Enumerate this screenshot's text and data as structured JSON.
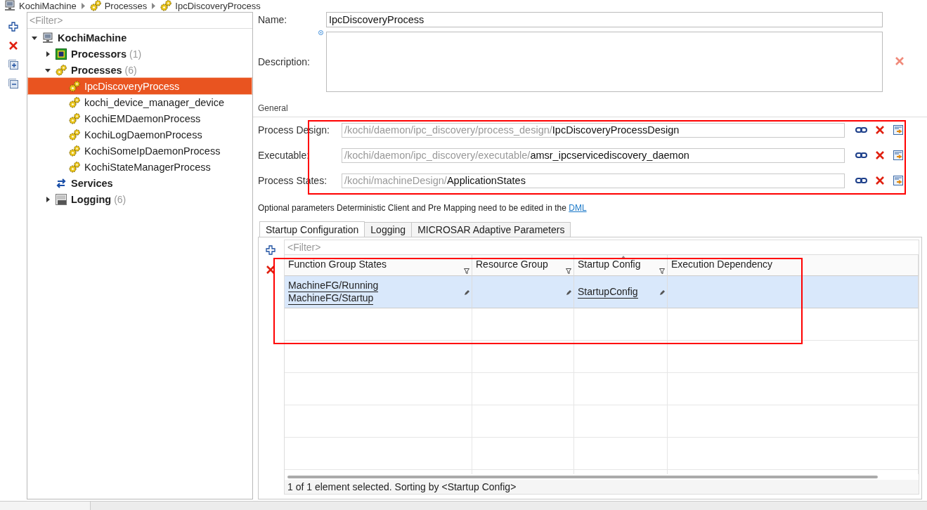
{
  "breadcrumb": [
    {
      "label": "KochiMachine",
      "kind": "machine"
    },
    {
      "label": "Processes",
      "kind": "process"
    },
    {
      "label": "IpcDiscoveryProcess",
      "kind": "process"
    }
  ],
  "tree": {
    "filter_placeholder": "<Filter>",
    "items": [
      {
        "label": "KochiMachine",
        "kind": "machine",
        "expanded": true,
        "selected": false,
        "children": [
          {
            "label": "Processors",
            "count": "(1)",
            "kind": "processor",
            "expanded": false,
            "selected": false
          },
          {
            "label": "Processes",
            "count": "(6)",
            "kind": "process",
            "expanded": true,
            "selected": false,
            "children": [
              {
                "label": "IpcDiscoveryProcess",
                "kind": "process",
                "selected": true
              },
              {
                "label": "kochi_device_manager_device",
                "kind": "process",
                "selected": false
              },
              {
                "label": "KochiEMDaemonProcess",
                "kind": "process",
                "selected": false
              },
              {
                "label": "KochiLogDaemonProcess",
                "kind": "process",
                "selected": false
              },
              {
                "label": "KochiSomeIpDaemonProcess",
                "kind": "process",
                "selected": false
              },
              {
                "label": "KochiStateManagerProcess",
                "kind": "process",
                "selected": false
              }
            ]
          },
          {
            "label": "Services",
            "kind": "services",
            "selected": false
          },
          {
            "label": "Logging",
            "count": "(6)",
            "kind": "logging",
            "expanded": false,
            "selected": false
          }
        ]
      }
    ]
  },
  "form": {
    "name": {
      "label": "Name:",
      "value": "IpcDiscoveryProcess"
    },
    "description": {
      "label": "Description:"
    },
    "section": "General",
    "references": {
      "highlighted": true,
      "items": [
        {
          "label": "Process Design:",
          "path": "/kochi/daemon/ipc_discovery/process_design/",
          "target": "IpcDiscoveryProcessDesign"
        },
        {
          "label": "Executable:",
          "path": "/kochi/daemon/ipc_discovery/executable/",
          "target": "amsr_ipcservicediscovery_daemon"
        },
        {
          "label": "Process States:",
          "path": "/kochi/machineDesign/",
          "target": "ApplicationStates"
        }
      ]
    },
    "note": {
      "text": "Optional parameters Deterministic Client and Pre Mapping need to be edited in the",
      "link": "DML"
    }
  },
  "tabs": [
    {
      "label": "Startup Configuration",
      "selected": true
    },
    {
      "label": "Logging",
      "selected": false
    },
    {
      "label": "MICROSAR Adaptive Parameters",
      "selected": false
    }
  ],
  "table": {
    "filter_placeholder": "<Filter>",
    "highlighted": true,
    "columns": [
      {
        "label": "Function Group States",
        "filter": true,
        "sorted": false
      },
      {
        "label": "Resource Group",
        "filter": true,
        "sorted": false
      },
      {
        "label": "Startup Config",
        "filter": true,
        "sorted": true
      },
      {
        "label": "Execution Dependency",
        "filter": false,
        "sorted": false
      }
    ],
    "rows": [
      {
        "selected": true,
        "cells": [
          {
            "values": [
              "MachineFG/Running",
              "MachineFG/Startup"
            ],
            "editable": true
          },
          {
            "editable": true
          },
          {
            "values": [
              "StartupConfig"
            ],
            "editable": true
          },
          {
            "editable": false
          }
        ]
      }
    ],
    "status": "1 of 1 element selected. Sorting by <Startup Config>"
  }
}
